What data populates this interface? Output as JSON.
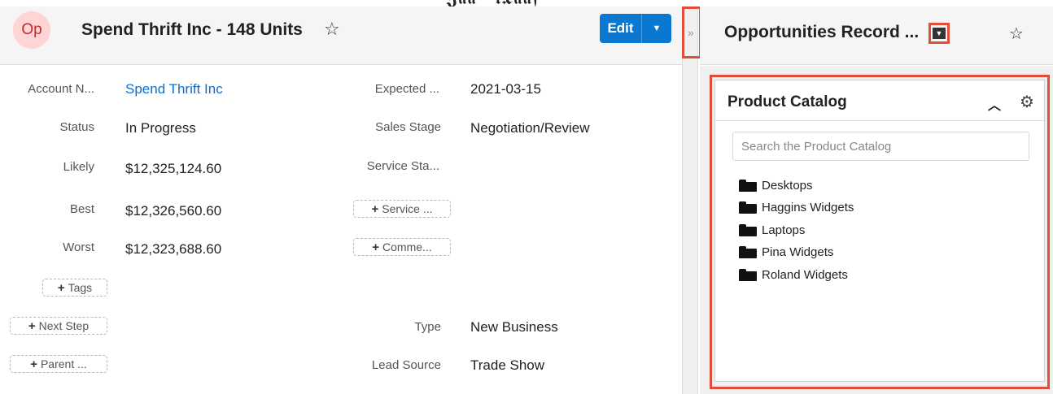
{
  "record": {
    "avatar_text": "Op",
    "title": "Spend Thrift Inc - 148 Units",
    "edit_label": "Edit"
  },
  "fields_left": [
    {
      "label": "Account N...",
      "value": "Spend Thrift Inc",
      "is_link": true
    },
    {
      "label": "Status",
      "value": "In Progress"
    },
    {
      "label": "Likely",
      "value": "$12,325,124.60"
    },
    {
      "label": "Best",
      "value": "$12,326,560.60"
    },
    {
      "label": "Worst",
      "value": "$12,323,688.60"
    }
  ],
  "fields_right": [
    {
      "label": "Expected ...",
      "value": "2021-03-15"
    },
    {
      "label": "Sales Stage",
      "value": "Negotiation/Review"
    },
    {
      "label": "Service Sta...",
      "value": ""
    },
    {
      "label": "Type",
      "value": "New Business"
    },
    {
      "label": "Lead Source",
      "value": "Trade Show"
    }
  ],
  "add_buttons": {
    "service": "Service ...",
    "comment": "Comme...",
    "tags": "Tags",
    "next_step": "Next Step",
    "parent": "Parent ..."
  },
  "side_panel": {
    "title": "Opportunities Record ...",
    "dashlet_title": "Product Catalog",
    "search_placeholder": "Search the Product Catalog",
    "catalog_items": [
      "Desktops",
      "Haggins Widgets",
      "Laptops",
      "Pina Widgets",
      "Roland Widgets"
    ]
  },
  "colors": {
    "primary_button": "#0a78d1",
    "link": "#0a6fd0",
    "highlight": "#e24c3a",
    "avatar_bg": "#ffd4d4",
    "avatar_fg": "#c62828"
  },
  "icons": {
    "favorite": "star-outline-icon",
    "dropdown": "caret-down-icon",
    "collapse": "chevron-up-icon",
    "settings": "gear-icon",
    "folder": "folder-icon",
    "plus": "plus-icon",
    "toggle": "double-chevron-right-icon"
  }
}
